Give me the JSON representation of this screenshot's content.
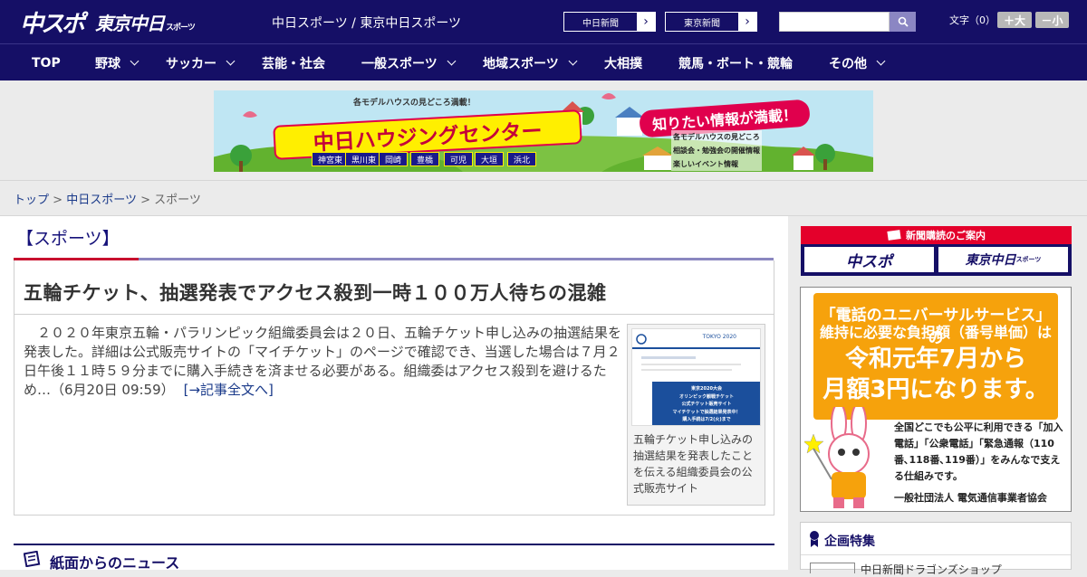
{
  "header": {
    "logo_main": "中スポ",
    "logo_sub": "東京中日",
    "logo_sub_small": "スポーツ",
    "site_title": "中日スポーツ / 東京中日スポーツ",
    "btn_chunichi": "中日新聞",
    "btn_tokyo": "東京新聞",
    "arrow": "›",
    "search_placeholder": "",
    "font_size_label": "文字（0）",
    "font_plus": "＋大",
    "font_minus": "－小"
  },
  "nav": {
    "items": [
      {
        "label": "TOP"
      },
      {
        "label": "野球"
      },
      {
        "label": "サッカー"
      },
      {
        "label": "芸能・社会"
      },
      {
        "label": "一般スポーツ"
      },
      {
        "label": "地域スポーツ"
      },
      {
        "label": "大相撲"
      },
      {
        "label": "競馬・ボート・競輪"
      },
      {
        "label": "その他"
      }
    ]
  },
  "banner": {
    "top_text": "各モデルハウスの見どころ満載！",
    "title": "中日ハウジングセンター",
    "right_title": "知りたい情報が満載！",
    "bullet1": "各モデルハウスの見どころ",
    "bullet2": "相談会・勉強会の開催情報",
    "bullet3": "楽しいイベント情報",
    "locations": [
      "神宮東",
      "黒川東",
      "岡崎",
      "豊橋",
      "可児",
      "大垣",
      "浜北"
    ]
  },
  "breadcrumb": {
    "top": "トップ",
    "sep": ">",
    "section": "中日スポーツ",
    "current": "スポーツ"
  },
  "category": "【スポーツ】",
  "article": {
    "headline": "五輪チケット、抽選発表でアクセス殺到一時１００万人待ちの混雑",
    "body": "２０２０年東京五輪・パラリンピック組織委員会は２０日、五輪チケット申し込みの抽選結果を発表した。詳細は公式販売サイトの「マイチケット」のページで確認でき、当選した場合は７月２日午後１１時５９分までに購入手続きを済ませる必要がある。組織委はアクセス殺到を避けるため…（6月20日 09:59）",
    "more_link": "[→記事全文へ]",
    "photo_caption": "五輪チケット申し込みの抽選結果を発表したことを伝える組織委員会の公式販売サイト",
    "photo_text": {
      "brand": "TOKYO 2020",
      "l1": "東京2020大会",
      "l2": "オリンピック観戦チケット",
      "l3": "公式チケット販売サイト",
      "l4": "マイチケットで抽選結果発表中！",
      "l5": "購入手続は7/2(火)まで"
    }
  },
  "news_section": {
    "title": "紙面からのニュース"
  },
  "sidebar": {
    "subscribe_title": "新聞購読のご案内",
    "subscribe_chuspo": "中スポ",
    "subscribe_tokyo": "東京中日",
    "subscribe_tokyo_small": "スポーツ",
    "ad": {
      "line1": "「電話のユニバーサルサービス」の",
      "line1b": "維持に必要な負担額（番号単価）は",
      "line2": "令和元年7月から",
      "line3": "月額3円になります。",
      "text": "全国どこでも公平に利用できる「加入電話」「公衆電話」「緊急通報（110番､118番､119番）」をみんなで支える仕組みです。",
      "org": "一般社団法人 電気通信事業者協会"
    },
    "feature_title": "企画特集",
    "feature_item": "中日新聞ドラゴンズショップ"
  },
  "colors": {
    "navy": "#150f66",
    "red": "#c8102e",
    "orange": "#f6a20c",
    "link": "#1a3a8a"
  }
}
